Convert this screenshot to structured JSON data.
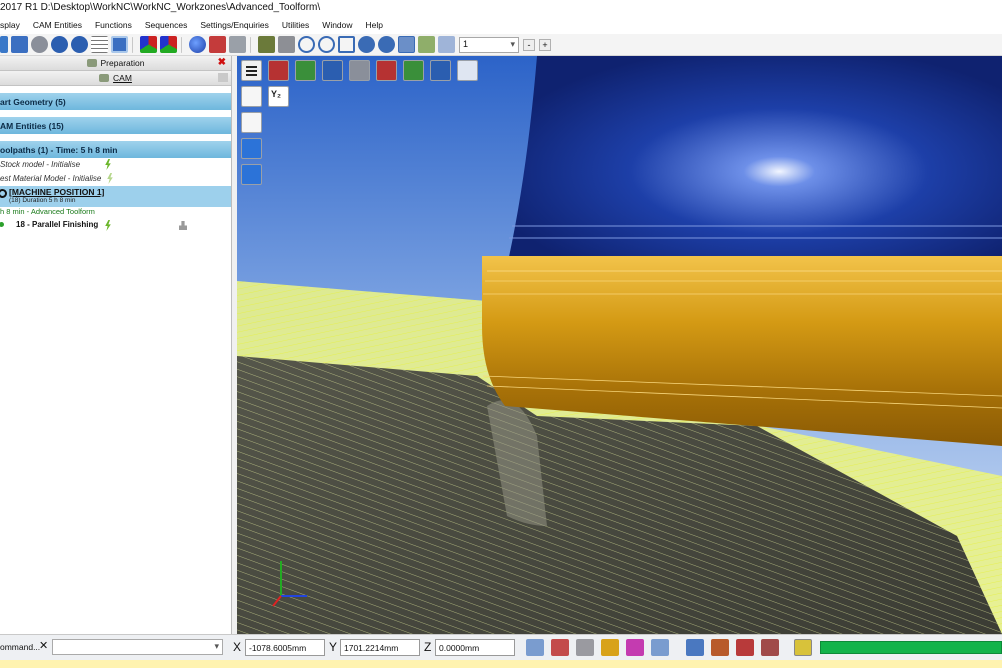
{
  "window": {
    "title": "2017 R1 D:\\Desktop\\WorkNC\\WorkNC_Workzones\\Advanced_Toolform\\"
  },
  "menu": [
    "splay",
    "CAM Entities",
    "Functions",
    "Sequences",
    "Settings/Enquiries",
    "Utilities",
    "Window",
    "Help"
  ],
  "toolbar": {
    "combo_value": "1",
    "minus": "-",
    "plus": "+"
  },
  "panel": {
    "tab_preparation": "Preparation",
    "tab_cam": "CAM",
    "sections": [
      "art Geometry (5)",
      "AM Entities (15)",
      "oolpaths (1) - Time: 5 h 8 min"
    ],
    "items": {
      "stock_model": "Stock model - Initialise",
      "rest_material": "est Material Model - Initialise",
      "machine_position": "[MACHINE POSITION 1]",
      "duration": "(18) Duration 5 h 8 min",
      "toolform": "h 8 min - Advanced Toolform",
      "finishing": "18 - Parallel Finishing"
    }
  },
  "viewport": {
    "axis_label": "Y₂"
  },
  "status": {
    "command_label": "ommand...",
    "x_label": "X",
    "x_value": "-1078.6005mm",
    "y_label": "Y",
    "y_value": "1701.2214mm",
    "z_label": "Z",
    "z_value": "0.0000mm",
    "progress_fraction": 1.0
  },
  "colors": {
    "tool_blue": "#1d3fa8",
    "tool_gold": "#d49a14",
    "toolpath_yellow": "#e6f04a",
    "section_blue": "#7fc0e3",
    "progress_green": "#12b34a"
  }
}
